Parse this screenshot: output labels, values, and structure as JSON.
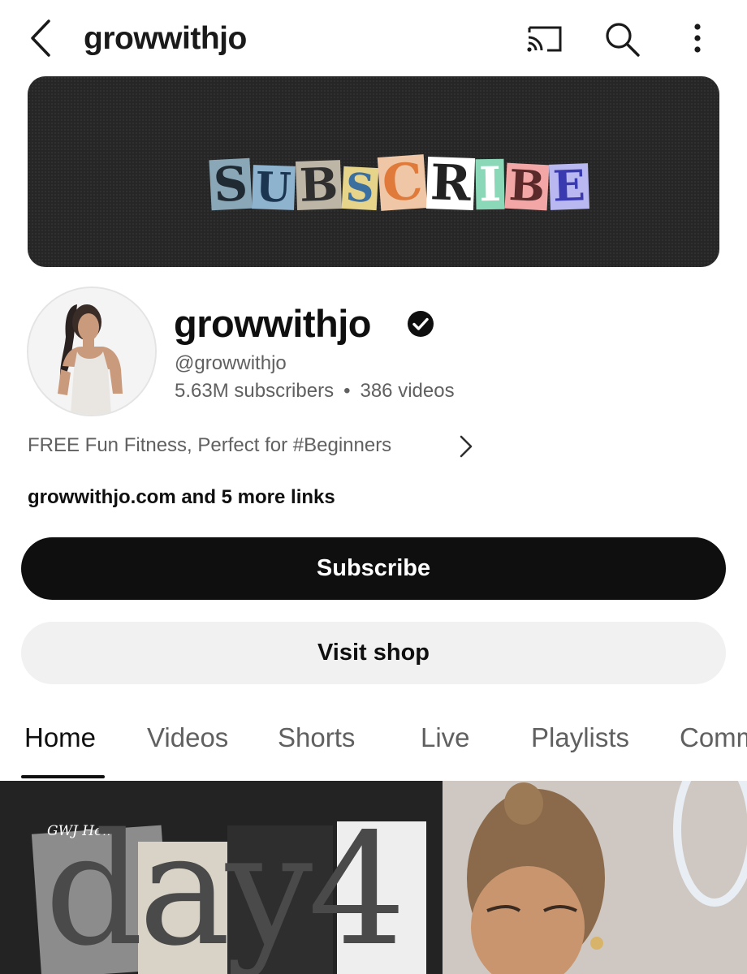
{
  "header": {
    "title": "growwithjo",
    "icons": [
      "back-arrow-icon",
      "cast-icon",
      "search-icon",
      "more-vert-icon"
    ]
  },
  "banner": {
    "letters": [
      "S",
      "U",
      "B",
      "S",
      "C",
      "R",
      "I",
      "B",
      "E"
    ],
    "colors": [
      "#8aa7b8",
      "#8db3cf",
      "#bdb6a7",
      "#6f9fbf",
      "#e6d48a",
      "#efc7a6",
      "#ffffff",
      "#8bd8b8",
      "#f2a6a6",
      "#b9b8f0"
    ]
  },
  "channel": {
    "name": "growwithjo",
    "handle": "@growwithjo",
    "subscribers": "5.63M subscribers",
    "separator": "•",
    "videos": "386 videos",
    "description": "FREE Fun Fitness, Perfect for #Beginners",
    "links": "growwithjo.com and 5 more links"
  },
  "buttons": {
    "subscribe": "Subscribe",
    "visit_shop": "Visit shop"
  },
  "tabs": [
    {
      "label": "Home",
      "active": true
    },
    {
      "label": "Videos",
      "active": false
    },
    {
      "label": "Shorts",
      "active": false
    },
    {
      "label": "Live",
      "active": false
    },
    {
      "label": "Playlists",
      "active": false
    },
    {
      "label": "Comm",
      "active": false
    }
  ],
  "thumbnail": {
    "title_text": "day4",
    "brand_text": "GWJ Home"
  },
  "colors": {
    "text_primary": "#0f0f0f",
    "text_secondary": "#606060",
    "button_dark": "#0f0f0f",
    "button_light": "#f1f1f1"
  }
}
